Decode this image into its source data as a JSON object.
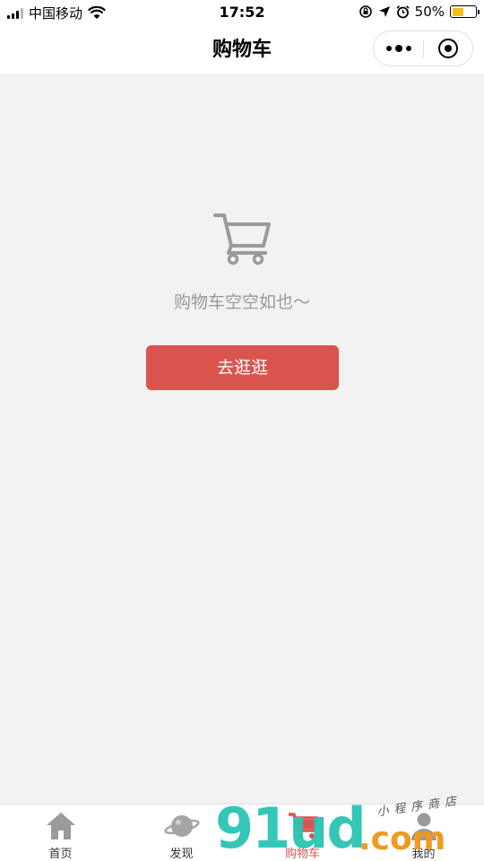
{
  "status_bar": {
    "carrier": "中国移动",
    "time": "17:52",
    "battery": "50%",
    "battery_level": 0.5
  },
  "nav": {
    "title": "购物车"
  },
  "empty_state": {
    "message": "购物车空空如也～",
    "button_label": "去逛逛"
  },
  "tabs": [
    {
      "label": "首页",
      "icon": "home-icon"
    },
    {
      "label": "发现",
      "icon": "planet-icon"
    },
    {
      "label": "购物车",
      "icon": "cart-icon",
      "active": true
    },
    {
      "label": "我的",
      "icon": "user-icon"
    }
  ],
  "watermark": {
    "brand": "91ud",
    "suffix": ".com",
    "tagline": "小程序商店"
  },
  "colors": {
    "accent": "#d9544e",
    "background": "#f2f2f2",
    "muted_text": "#999999",
    "watermark_teal": "#2ac4b3",
    "watermark_orange": "#f19a1d"
  }
}
